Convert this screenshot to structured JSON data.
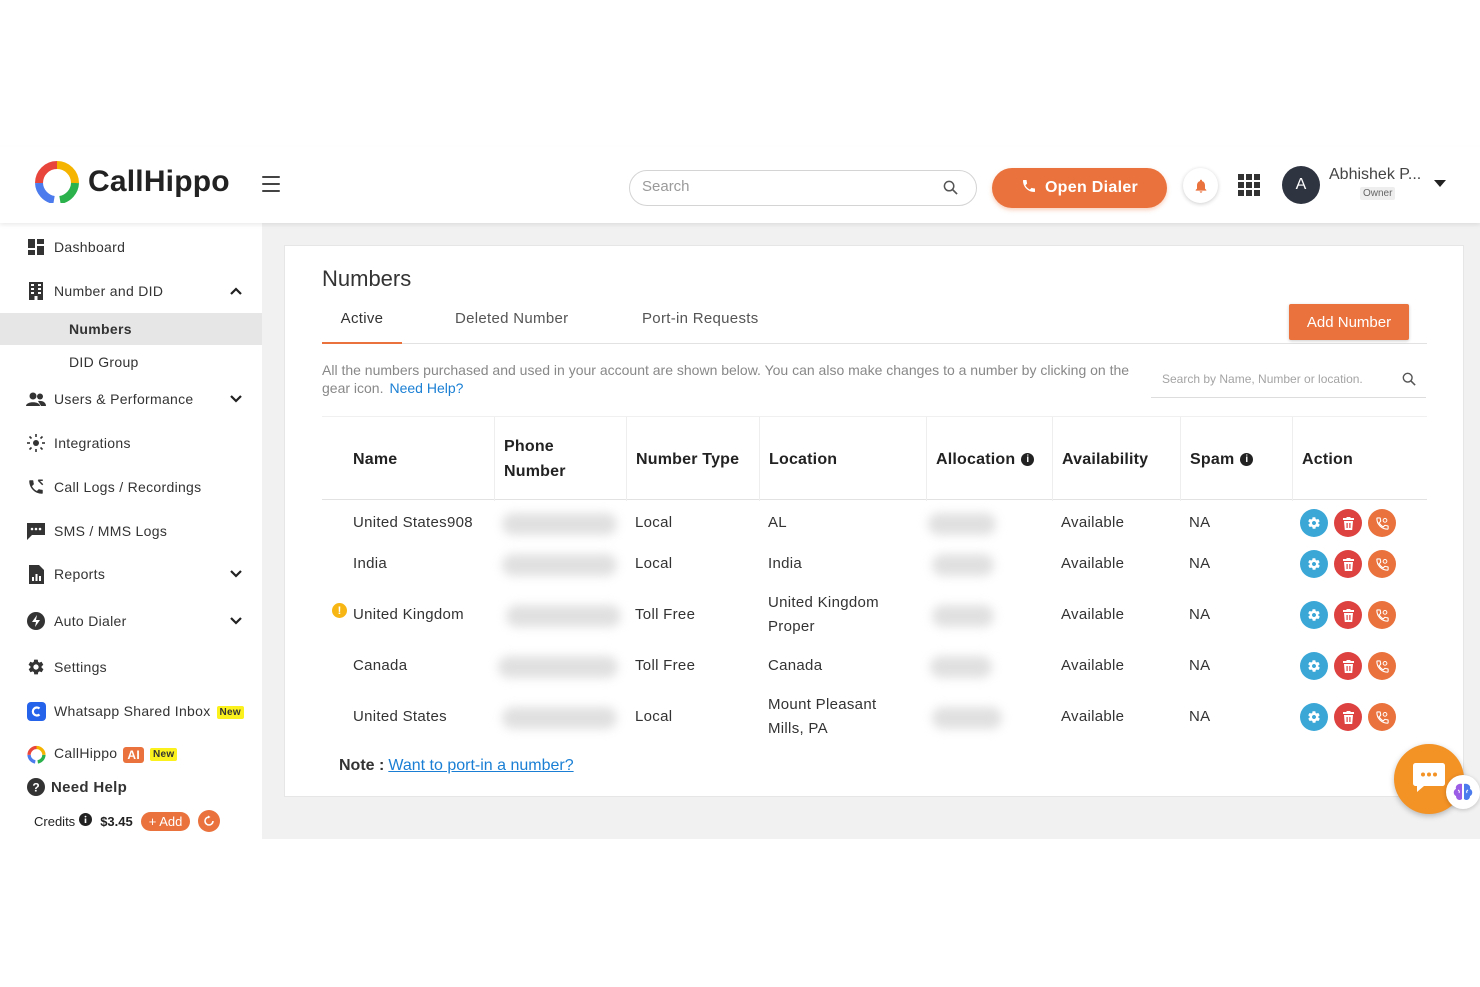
{
  "header": {
    "brand": "CallHippo",
    "search_placeholder": "Search",
    "open_dialer": "Open Dialer",
    "user_initial": "A",
    "user_name": "Abhishek P...",
    "user_role": "Owner"
  },
  "sidebar": {
    "items": [
      {
        "label": "Dashboard"
      },
      {
        "label": "Number and DID"
      },
      {
        "label": "Numbers"
      },
      {
        "label": "DID Group"
      },
      {
        "label": "Users & Performance"
      },
      {
        "label": "Integrations"
      },
      {
        "label": "Call Logs / Recordings"
      },
      {
        "label": "SMS / MMS Logs"
      },
      {
        "label": "Reports"
      },
      {
        "label": "Auto Dialer"
      },
      {
        "label": "Settings"
      },
      {
        "label": "Whatsapp Shared Inbox",
        "badge": "New"
      },
      {
        "label": "CallHippo",
        "ai": "AI",
        "badge": "New"
      },
      {
        "label": "Need Help"
      }
    ],
    "credits_label": "Credits",
    "credits_value": "$3.45",
    "add_label": "+ Add"
  },
  "page": {
    "title": "Numbers",
    "tabs": [
      "Active",
      "Deleted Number",
      "Port-in Requests"
    ],
    "add_number": "Add Number",
    "info_text": "All the numbers purchased and used in your account are shown below. You can also make changes to a number by clicking on the gear icon.",
    "need_help": "Need Help?",
    "table_search_placeholder": "Search by Name, Number or location.",
    "note_label": "Note :",
    "note_link": "Want to port-in a number?"
  },
  "table": {
    "headers": [
      "Name",
      "Phone Number",
      "Number Type",
      "Location",
      "Allocation",
      "Availability",
      "Spam",
      "Action"
    ],
    "rows": [
      {
        "name": "United States908",
        "type": "Local",
        "location": "AL",
        "availability": "Available",
        "spam": "NA"
      },
      {
        "name": "India",
        "type": "Local",
        "location": "India",
        "availability": "Available",
        "spam": "NA"
      },
      {
        "name": "United Kingdom",
        "type": "Toll Free",
        "location": "United Kingdom Proper",
        "availability": "Available",
        "spam": "NA",
        "warning": "!"
      },
      {
        "name": "Canada",
        "type": "Toll Free",
        "location": "Canada",
        "availability": "Available",
        "spam": "NA"
      },
      {
        "name": "United States",
        "type": "Local",
        "location": "Mount Pleasant Mills, PA",
        "availability": "Available",
        "spam": "NA"
      }
    ]
  },
  "colors": {
    "accent": "#e9723d",
    "gear": "#3aa7d7",
    "delete": "#dd4240",
    "link": "#1a7fd4"
  }
}
